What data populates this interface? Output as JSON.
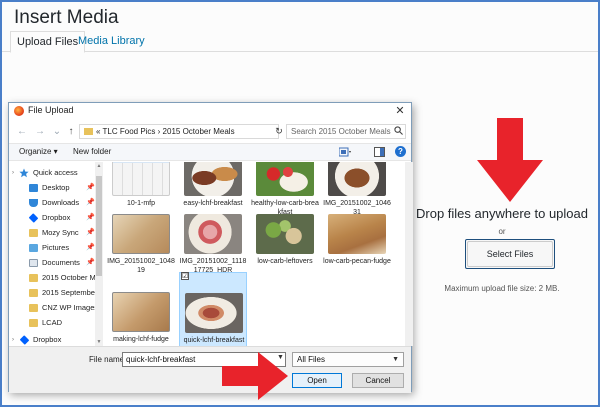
{
  "modal": {
    "title": "Insert Media",
    "tabs": [
      {
        "label": "Upload Files"
      },
      {
        "label": "Media Library"
      }
    ],
    "upload": {
      "drop_text": "Drop files anywhere to upload",
      "or_text": "or",
      "select_button": "Select Files",
      "max_size": "Maximum upload file size: 2 MB."
    }
  },
  "dialog": {
    "title": "File Upload",
    "close_glyph": "✕",
    "path": "«  TLC Food Pics  ›  2015 October Meals",
    "search_placeholder": "Search 2015 October Meals",
    "toolbar": {
      "organize": "Organize ▾",
      "new_folder": "New folder",
      "help_glyph": "?"
    },
    "nav_items": [
      {
        "label": "Quick access",
        "icon": "star-icon"
      },
      {
        "label": "Desktop",
        "icon": "desktop-icon"
      },
      {
        "label": "Downloads",
        "icon": "download-icon"
      },
      {
        "label": "Dropbox",
        "icon": "dropbox-icon"
      },
      {
        "label": "Mozy Sync",
        "icon": "sync-icon"
      },
      {
        "label": "Pictures",
        "icon": "pictures-icon"
      },
      {
        "label": "Documents",
        "icon": "documents-icon"
      },
      {
        "label": "2015 October Me",
        "icon": "folder-icon"
      },
      {
        "label": "2015 September",
        "icon": "folder-icon"
      },
      {
        "label": "CNZ WP Images",
        "icon": "folder-icon"
      },
      {
        "label": "LCAD",
        "icon": "folder-icon"
      },
      {
        "label": "Dropbox",
        "icon": "dropbox-icon"
      }
    ],
    "files": [
      {
        "label": "10-1-mfp"
      },
      {
        "label": "easy-lchf-breakfast"
      },
      {
        "label": "healthy-low-carb-breakfast"
      },
      {
        "label": "IMG_20151002_104631"
      },
      {
        "label": "IMG_20151002_104819"
      },
      {
        "label": "IMG_20151002_111817725_HDR"
      },
      {
        "label": "low-carb-leftovers"
      },
      {
        "label": "low-carb-pecan-fudge"
      },
      {
        "label": "making-lchf-fudge"
      },
      {
        "label": "quick-lchf-breakfast"
      }
    ],
    "checkbox_glyph": "☑",
    "file_name_label": "File name:",
    "file_name_value": "quick-lchf-breakfast",
    "file_type": "All Files",
    "open_button": "Open",
    "cancel_button": "Cancel"
  },
  "colors": {
    "frame_border": "#4a7fc9",
    "link_blue": "#0073aa",
    "arrow_red": "#e8232b",
    "selection": "#cce8ff"
  }
}
